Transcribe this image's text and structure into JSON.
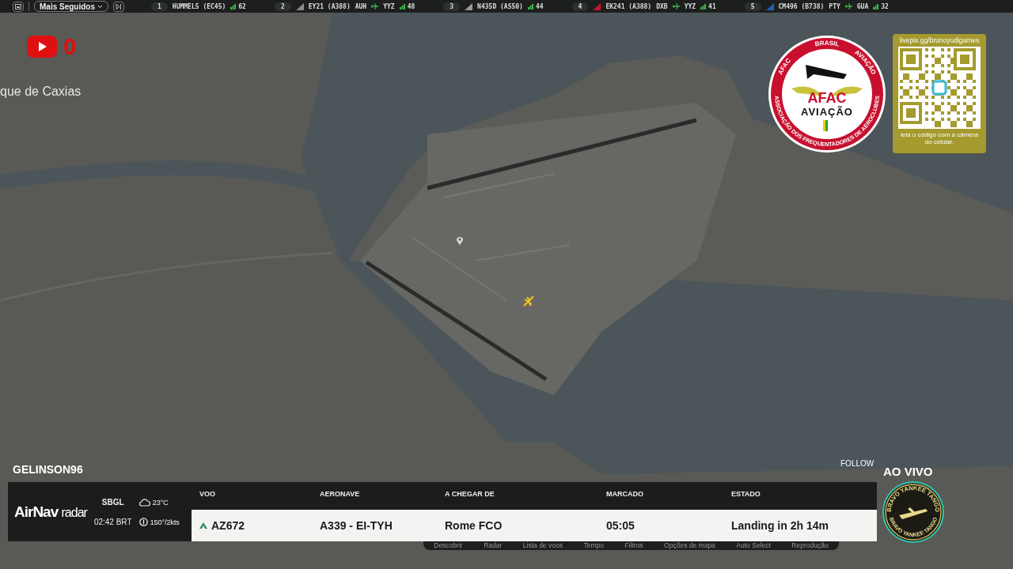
{
  "top_bar": {
    "dropdown": "Mais Seguidos",
    "ticker": [
      {
        "rank": "1",
        "flight": "HUMMEL5 (EC45)",
        "count": "62"
      },
      {
        "rank": "2",
        "flight": "EY21 (A388)",
        "from": "AUH",
        "to": "YYZ",
        "count": "48",
        "color": "#8a8a8a"
      },
      {
        "rank": "3",
        "flight": "N435D (AS50)",
        "count": "44",
        "color": "#9a9a9a"
      },
      {
        "rank": "4",
        "flight": "EK241 (A388)",
        "from": "DXB",
        "to": "YYZ",
        "count": "41",
        "color": "#c8102e"
      },
      {
        "rank": "5",
        "flight": "CM496 (B738)",
        "from": "PTY",
        "to": "GUA",
        "count": "32",
        "color": "#1f5fb0"
      }
    ]
  },
  "youtube": {
    "count": "0"
  },
  "map": {
    "place_label": "que de Caxias"
  },
  "afac_logo": {
    "ring_top": "BRASIL",
    "ring_left": "AFAC",
    "ring_right": "AVIAÇÃO",
    "ring_bottom": "ASSOCIAÇÃO DOS FREQUENTADORES DE AEROCLUBES",
    "name": "AFAC",
    "subtitle": "AVIAÇÃO"
  },
  "qr_card": {
    "url": "livepix.gg/brunoyudigames",
    "caption": "leia o código com a câmera do celular."
  },
  "flight_panel": {
    "user": "GELINSON96",
    "follow": "FOLLOW",
    "brand_bold": "AirNav",
    "brand_light": "radar",
    "airport": "SBGL",
    "time": "02:42 BRT",
    "temperature": "23°C",
    "wind": "150°/2kts",
    "columns": [
      "VOO",
      "AERONAVE",
      "A CHEGAR DE",
      "MARCADO",
      "ESTADO"
    ],
    "row": [
      "AZ672",
      "A339 - EI-TYH",
      "Rome FCO",
      "05:05",
      "Landing in 2h 14m"
    ]
  },
  "bottom_menu": [
    "Descobrir",
    "Radar",
    "Lista de voos",
    "Tempo",
    "Filtros",
    "Opções de mapa",
    "Auto Select",
    "Reprodução"
  ],
  "live": {
    "label": "AO VIVO",
    "badge_top": "BRAVO YANKEE TANGO",
    "badge_bottom": "BRAVO YANKEE TANGO"
  }
}
